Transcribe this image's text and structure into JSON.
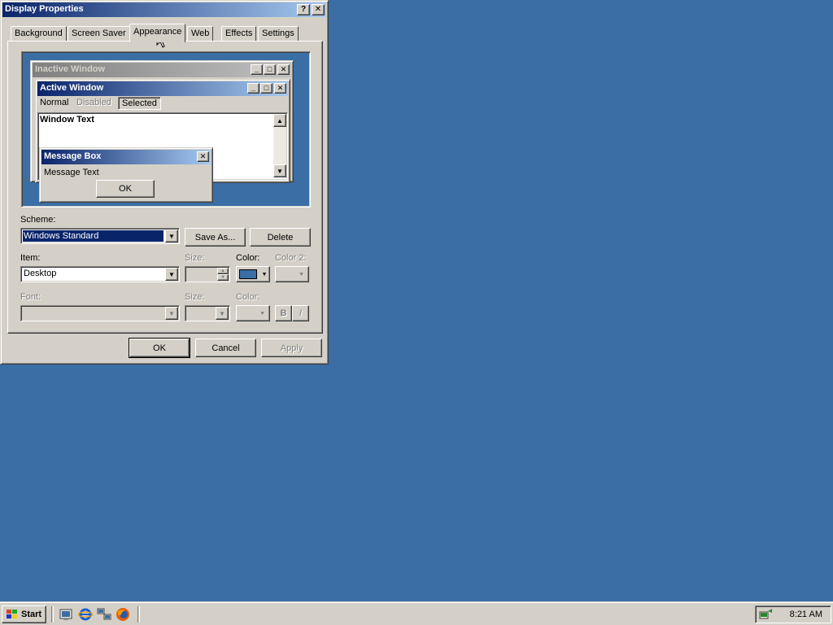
{
  "dialog": {
    "title": "Display Properties",
    "help_btn": "?",
    "close_btn": "✕",
    "tabs": [
      "Background",
      "Screen Saver",
      "Appearance",
      "Web",
      "Effects",
      "Settings"
    ],
    "active_tab": "Appearance"
  },
  "preview": {
    "inactive_title": "Inactive Window",
    "active_title": "Active Window",
    "menu": {
      "normal": "Normal",
      "disabled": "Disabled",
      "selected": "Selected"
    },
    "window_text": "Window Text",
    "msgbox_title": "Message Box",
    "msgbox_text": "Message Text",
    "msgbox_ok": "OK"
  },
  "form": {
    "scheme_label": "Scheme:",
    "scheme_value": "Windows Standard",
    "save_as": "Save As...",
    "delete": "Delete",
    "item_label": "Item:",
    "item_value": "Desktop",
    "size_label": "Size:",
    "color_label": "Color:",
    "color2_label": "Color 2:",
    "font_label": "Font:",
    "font_size_label": "Size:",
    "font_color_label": "Color:",
    "bold": "B",
    "italic": "I"
  },
  "footer": {
    "ok": "OK",
    "cancel": "Cancel",
    "apply": "Apply"
  },
  "taskbar": {
    "start": "Start",
    "clock": "8:21 AM"
  },
  "colors": {
    "desktop": "#3a6ea5",
    "item_color": "#3a6ea5",
    "title_active": "#0a246a"
  }
}
